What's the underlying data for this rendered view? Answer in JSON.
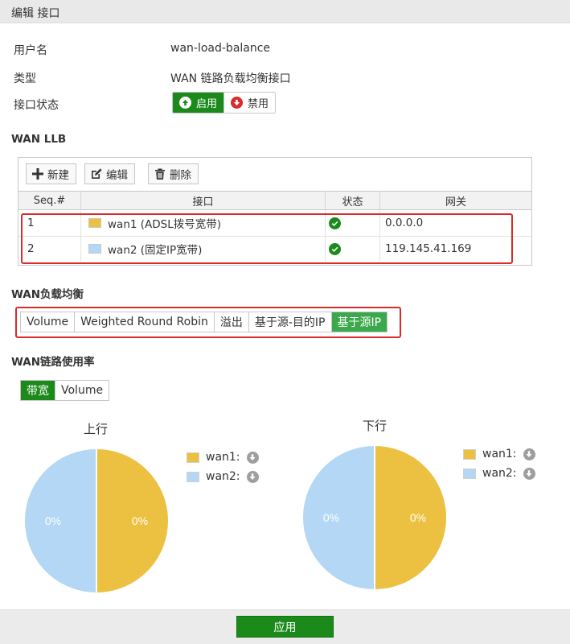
{
  "window": {
    "title": "编辑 接口"
  },
  "form": {
    "username_label": "用户名",
    "username_value": "wan-load-balance",
    "type_label": "类型",
    "type_value": "WAN 链路负载均衡接口",
    "status_label": "接口状态",
    "status_toggle": {
      "enable_label": "启用",
      "disable_label": "禁用",
      "selected": "启用"
    }
  },
  "llb": {
    "section_title": "WAN LLB",
    "toolbar": {
      "new_label": "新建",
      "edit_label": "编辑",
      "delete_label": "删除"
    },
    "columns": [
      "Seq.#",
      "接口",
      "状态",
      "网关"
    ],
    "rows": [
      {
        "seq": "1",
        "interface": "wan1 (ADSL拨号宽带)",
        "color": "#ecc040",
        "status": "enabled",
        "gateway": "0.0.0.0"
      },
      {
        "seq": "2",
        "interface": "wan2 (固定IP宽带)",
        "color": "#b3d7f4",
        "status": "enabled",
        "gateway": "119.145.41.169"
      }
    ]
  },
  "balance": {
    "section_title": "WAN负载均衡",
    "options": [
      "Volume",
      "Weighted Round Robin",
      "溢出",
      "基于源-目的IP",
      "基于源IP"
    ],
    "selected": "基于源IP"
  },
  "usage": {
    "section_title": "WAN链路使用率",
    "tabs": [
      "带宽",
      "Volume"
    ],
    "selected_tab": "带宽"
  },
  "chart_data": [
    {
      "type": "pie",
      "title": "上行",
      "categories": [
        "wan1:",
        "wan2:"
      ],
      "values": [
        50,
        50
      ],
      "labels": [
        "0%",
        "0%"
      ],
      "colors": [
        "#ecc040",
        "#b3d7f4"
      ],
      "legend": "right"
    },
    {
      "type": "pie",
      "title": "下行",
      "categories": [
        "wan1:",
        "wan2:"
      ],
      "values": [
        50,
        50
      ],
      "labels": [
        "0%",
        "0%"
      ],
      "colors": [
        "#ecc040",
        "#b3d7f4"
      ],
      "legend": "right"
    }
  ],
  "footer": {
    "apply_label": "应用"
  },
  "colors": {
    "accent": "#1b8a1b",
    "highlight": "#d92b2b"
  }
}
